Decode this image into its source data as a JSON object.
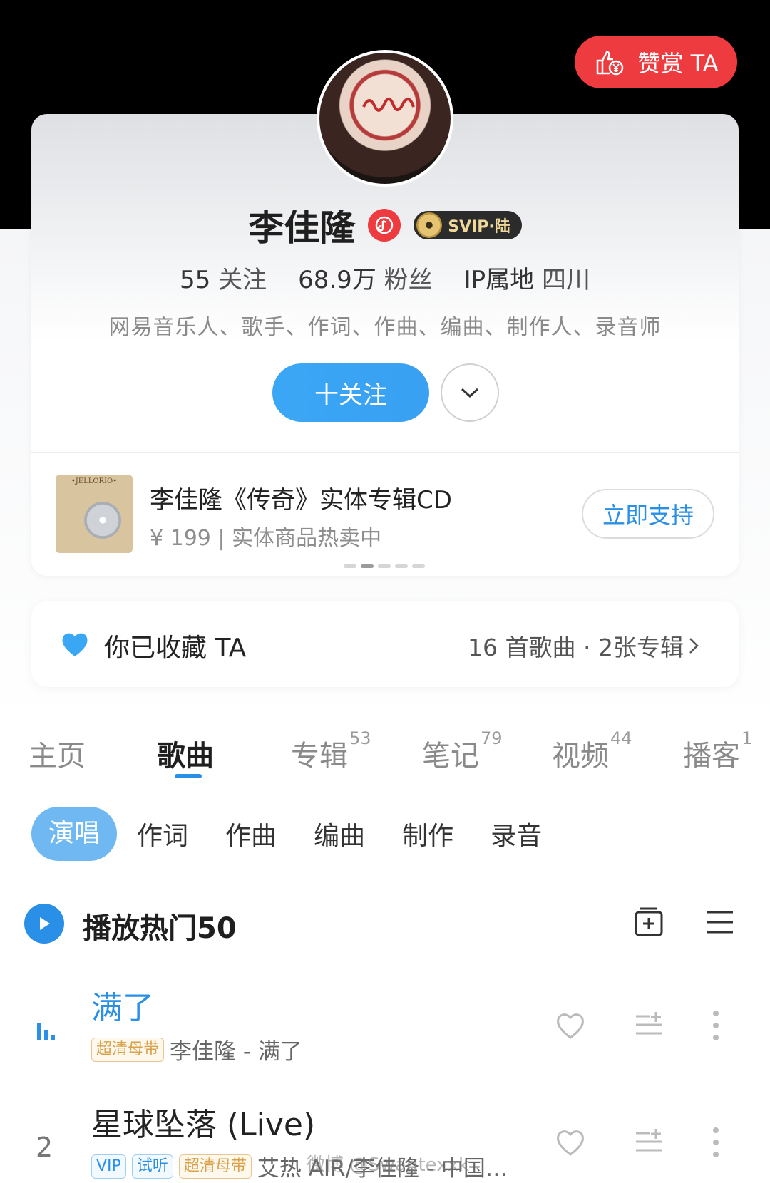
{
  "reward": {
    "label": "赞赏 TA"
  },
  "profile": {
    "name": "李佳隆",
    "vip_badge": "SVIP·陆",
    "stats": [
      {
        "value": "55",
        "label": "关注"
      },
      {
        "value": "68.9万",
        "label": "粉丝"
      },
      {
        "value": "IP属地",
        "label": "四川"
      }
    ],
    "tags": "网易音乐人、歌手、作词、作曲、编曲、制作人、录音师",
    "follow_label": "十关注"
  },
  "promo": {
    "thumb_text": "•JELLORIO•",
    "title": "李佳隆《传奇》实体专辑CD",
    "subtitle": "¥ 199 | 实体商品热卖中",
    "button": "立即支持",
    "page_count": 5,
    "active_page": 1
  },
  "collect": {
    "text": "你已收藏 TA",
    "meta": "16 首歌曲 · 2张专辑"
  },
  "tabs": [
    {
      "label": "主页",
      "count": ""
    },
    {
      "label": "歌曲",
      "count": ""
    },
    {
      "label": "专辑",
      "count": "53"
    },
    {
      "label": "笔记",
      "count": "79"
    },
    {
      "label": "视频",
      "count": "44"
    },
    {
      "label": "播客",
      "count": "1"
    }
  ],
  "subtabs": [
    "演唱",
    "作词",
    "作曲",
    "编曲",
    "制作",
    "录音"
  ],
  "play_all": {
    "label": "播放热门50"
  },
  "songs": [
    {
      "index": "",
      "title": "满了",
      "badges": [
        "超清母带"
      ],
      "artist": "李佳隆 - 满了",
      "playing": true
    },
    {
      "index": "2",
      "title": "星球坠落 (Live)",
      "badges": [
        "VIP",
        "试听",
        "超清母带"
      ],
      "artist": "艾热 AIR/李佳隆 - 中国…",
      "playing": false
    }
  ],
  "watermark": "微博 @Swagtexxk",
  "colors": {
    "accent": "#2a8fe6",
    "reward_red": "#ee3b3f",
    "follow_blue": "#3aa7f5"
  }
}
